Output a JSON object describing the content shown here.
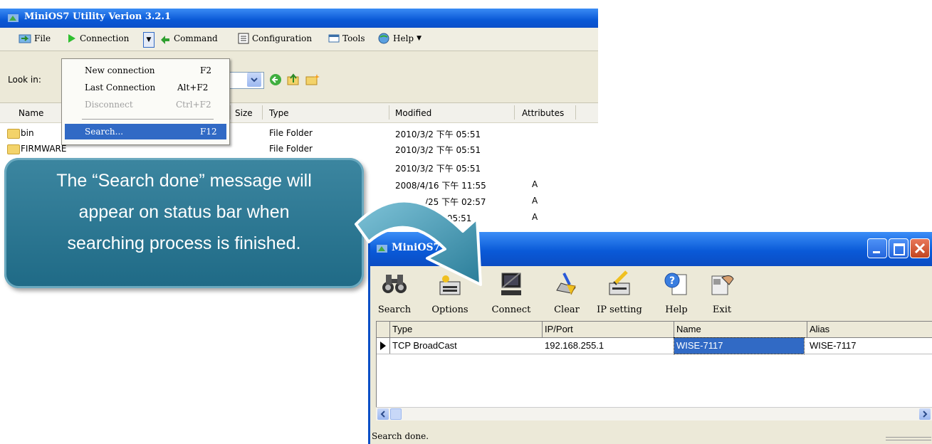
{
  "main_window": {
    "title": "MiniOS7 Utility Verion 3.2.1",
    "menu": [
      "File",
      "Connection",
      "Command",
      "Configuration",
      "Tools",
      "Help"
    ],
    "look_in_label": "Look in:",
    "columns": [
      "Name",
      "Size",
      "Type",
      "Modified",
      "Attributes"
    ],
    "files": [
      {
        "name": "bin",
        "type": "File Folder",
        "modified": "2010/3/2 下午 05:51",
        "attr": ""
      },
      {
        "name": "FIRMWARE",
        "type": "File Folder",
        "modified": "2010/3/2 下午 05:51",
        "attr": ""
      },
      {
        "name": "",
        "type": "",
        "modified": "2010/3/2 下午 05:51",
        "attr": ""
      },
      {
        "name": "",
        "type": "",
        "modified": "2008/4/16 下午 11:55",
        "attr": "A"
      },
      {
        "name": "",
        "type": "",
        "modified": "/25 下午 02:57",
        "attr": "A"
      },
      {
        "name": "",
        "type": "",
        "modified": "午 05:51",
        "attr": "A"
      }
    ]
  },
  "connection_menu": [
    {
      "label": "New connection",
      "shortcut": "F2"
    },
    {
      "label": "Last Connection",
      "shortcut": "Alt+F2"
    },
    {
      "label": "Disconnect",
      "shortcut": "Ctrl+F2"
    },
    {
      "label": "Search...",
      "shortcut": "F12"
    }
  ],
  "callout": {
    "line1": "The “Search done” message will",
    "line2": "appear on status bar when",
    "line3": "searching process is finished."
  },
  "scan_window": {
    "title": "MiniOS7 Scan",
    "tools": [
      "Search",
      "Options",
      "Connect",
      "Clear",
      "IP setting",
      "Help",
      "Exit"
    ],
    "columns": [
      "Type",
      "IP/Port",
      "Name",
      "Alias"
    ],
    "row": {
      "type": "TCP BroadCast",
      "ip": "192.168.255.1",
      "name": "WISE-7117",
      "alias": "WISE-7117"
    },
    "status": "Search done."
  },
  "colors": {
    "xp_blue": "#0a58d6",
    "selection": "#316ac5",
    "callout": "#1f6a86"
  }
}
